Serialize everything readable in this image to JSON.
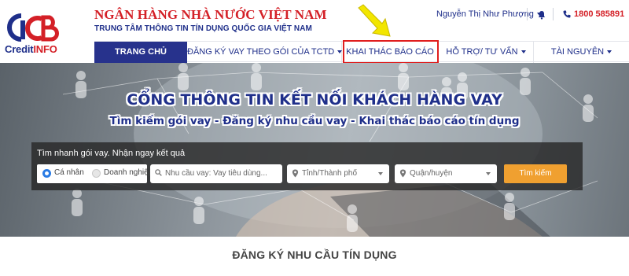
{
  "brand": {
    "logo_word": "CICB",
    "logo_credit": "Credit",
    "logo_info": "INFO",
    "bank_name": "NGÂN HÀNG NHÀ NƯỚC VIỆT NAM",
    "bank_sub": "TRUNG TÂM THÔNG TIN TÍN DỤNG QUỐC GIA VIỆT NAM",
    "primary_color": "#1f2f8a",
    "accent_color": "#d42027"
  },
  "topbar": {
    "user_name": "Nguyễn Thị Như Phượng",
    "bell_icon": "bell-icon",
    "phone_icon": "phone-icon",
    "phone": "1800 585891"
  },
  "nav": {
    "items": [
      {
        "label": "TRANG CHỦ",
        "active": true
      },
      {
        "label": "ĐĂNG KÝ VAY THEO GÓI CỦA TCTD",
        "dropdown": true
      },
      {
        "label": "KHAI THÁC BÁO CÁO",
        "highlighted": true
      },
      {
        "label": "HỖ TRỢ/ TƯ VẤN",
        "dropdown": true
      },
      {
        "label": "TÀI NGUYÊN",
        "dropdown": true
      }
    ],
    "highlight_color": "#e01e1e",
    "annotation_arrow_color": "#f2e600"
  },
  "hero": {
    "title": "CỔNG THÔNG TIN KẾT NỐI KHÁCH HÀNG VAY",
    "subtitle": "Tìm kiếm gói vay - Đăng ký nhu cầu vay - Khai thác báo cáo tín dụng"
  },
  "search": {
    "label": "Tìm nhanh gói vay. Nhận ngay kết quả",
    "radio_personal": "Cá nhân",
    "radio_business": "Doanh nghiệp",
    "selected": "Cá nhân",
    "need_placeholder": "Nhu cầu vay: Vay tiêu dùng...",
    "province_placeholder": "Tỉnh/Thành phố",
    "district_placeholder": "Quận/huyện",
    "button_label": "Tìm kiếm",
    "button_color": "#f0a030"
  },
  "section": {
    "title": "ĐĂNG KÝ NHU CẦU TÍN DỤNG"
  }
}
